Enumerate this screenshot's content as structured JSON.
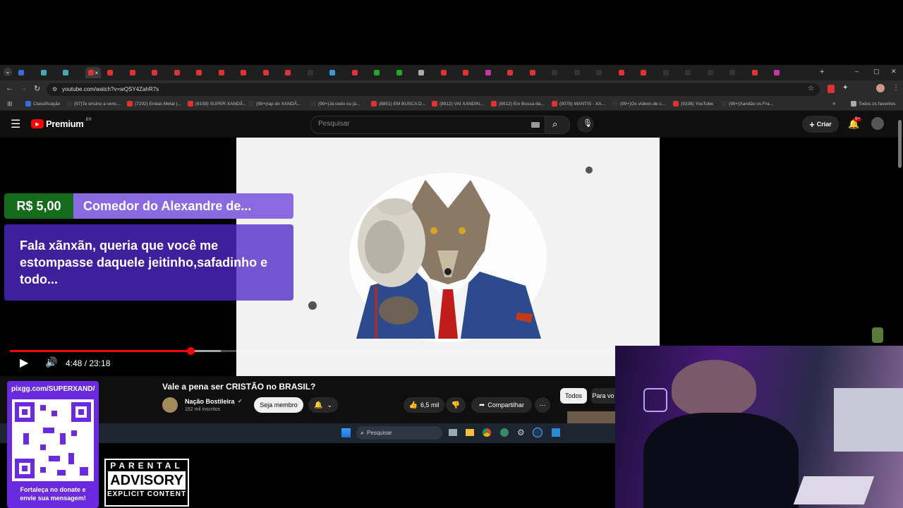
{
  "browser": {
    "tabs_active_label": "×",
    "url": "youtube.com/watch?v=wQSY4ZahR7s",
    "all_bookmarks": "Todos os favoritos",
    "bookmarks": [
      "Classificação",
      "(97)Te ensino a venc...",
      "(7292) Enéas Metal |...",
      "(8159) SUPER XANDÃ...",
      "(99+)rap do XANDÃ...",
      "(99+)Já cedo ou já...",
      "(8851) EM BUSCA D...",
      "(8912) VAI XANDIN...",
      "(8912) Em Busca da...",
      "(9078) MANTIS - XA...",
      "(99+)Os vídeos de c...",
      "(9338) YouTube",
      "(99+)Xandão vs Fra..."
    ]
  },
  "youtube": {
    "logo": "Premium",
    "logo_sup": "BR",
    "search_placeholder": "Pesquisar",
    "create_label": "Criar",
    "notif_badge": "9+"
  },
  "player": {
    "time": "4:48 / 23:18",
    "progress": 0.206,
    "loaded": 0.24
  },
  "donation": {
    "amount": "R$ 5,00",
    "name": "Comedor do Alexandre de...",
    "message": "Fala xãnxãn, queria que você me estompasse daquele jeitinho,safadinho e todo..."
  },
  "video": {
    "title": "Vale a pena ser CRISTÃO no BRASIL?",
    "channel": "Nação Bostileira",
    "subs": "152 mil inscritos",
    "join": "Seja membro",
    "likes": "6,5 mil",
    "share": "Compartilhar",
    "chip_all": "Todos",
    "chip_for_you": "Para vo"
  },
  "taskbar": {
    "search": "Pesquisar"
  },
  "overlay": {
    "pix": "pixgg.com/SUPERXAND/",
    "support": "Fortaleça no donate e envie sua mensagem!",
    "pa_top": "PARENTAL",
    "pa_mid": "ADVISORY",
    "pa_bot": "EXPLICIT CONTENT"
  }
}
